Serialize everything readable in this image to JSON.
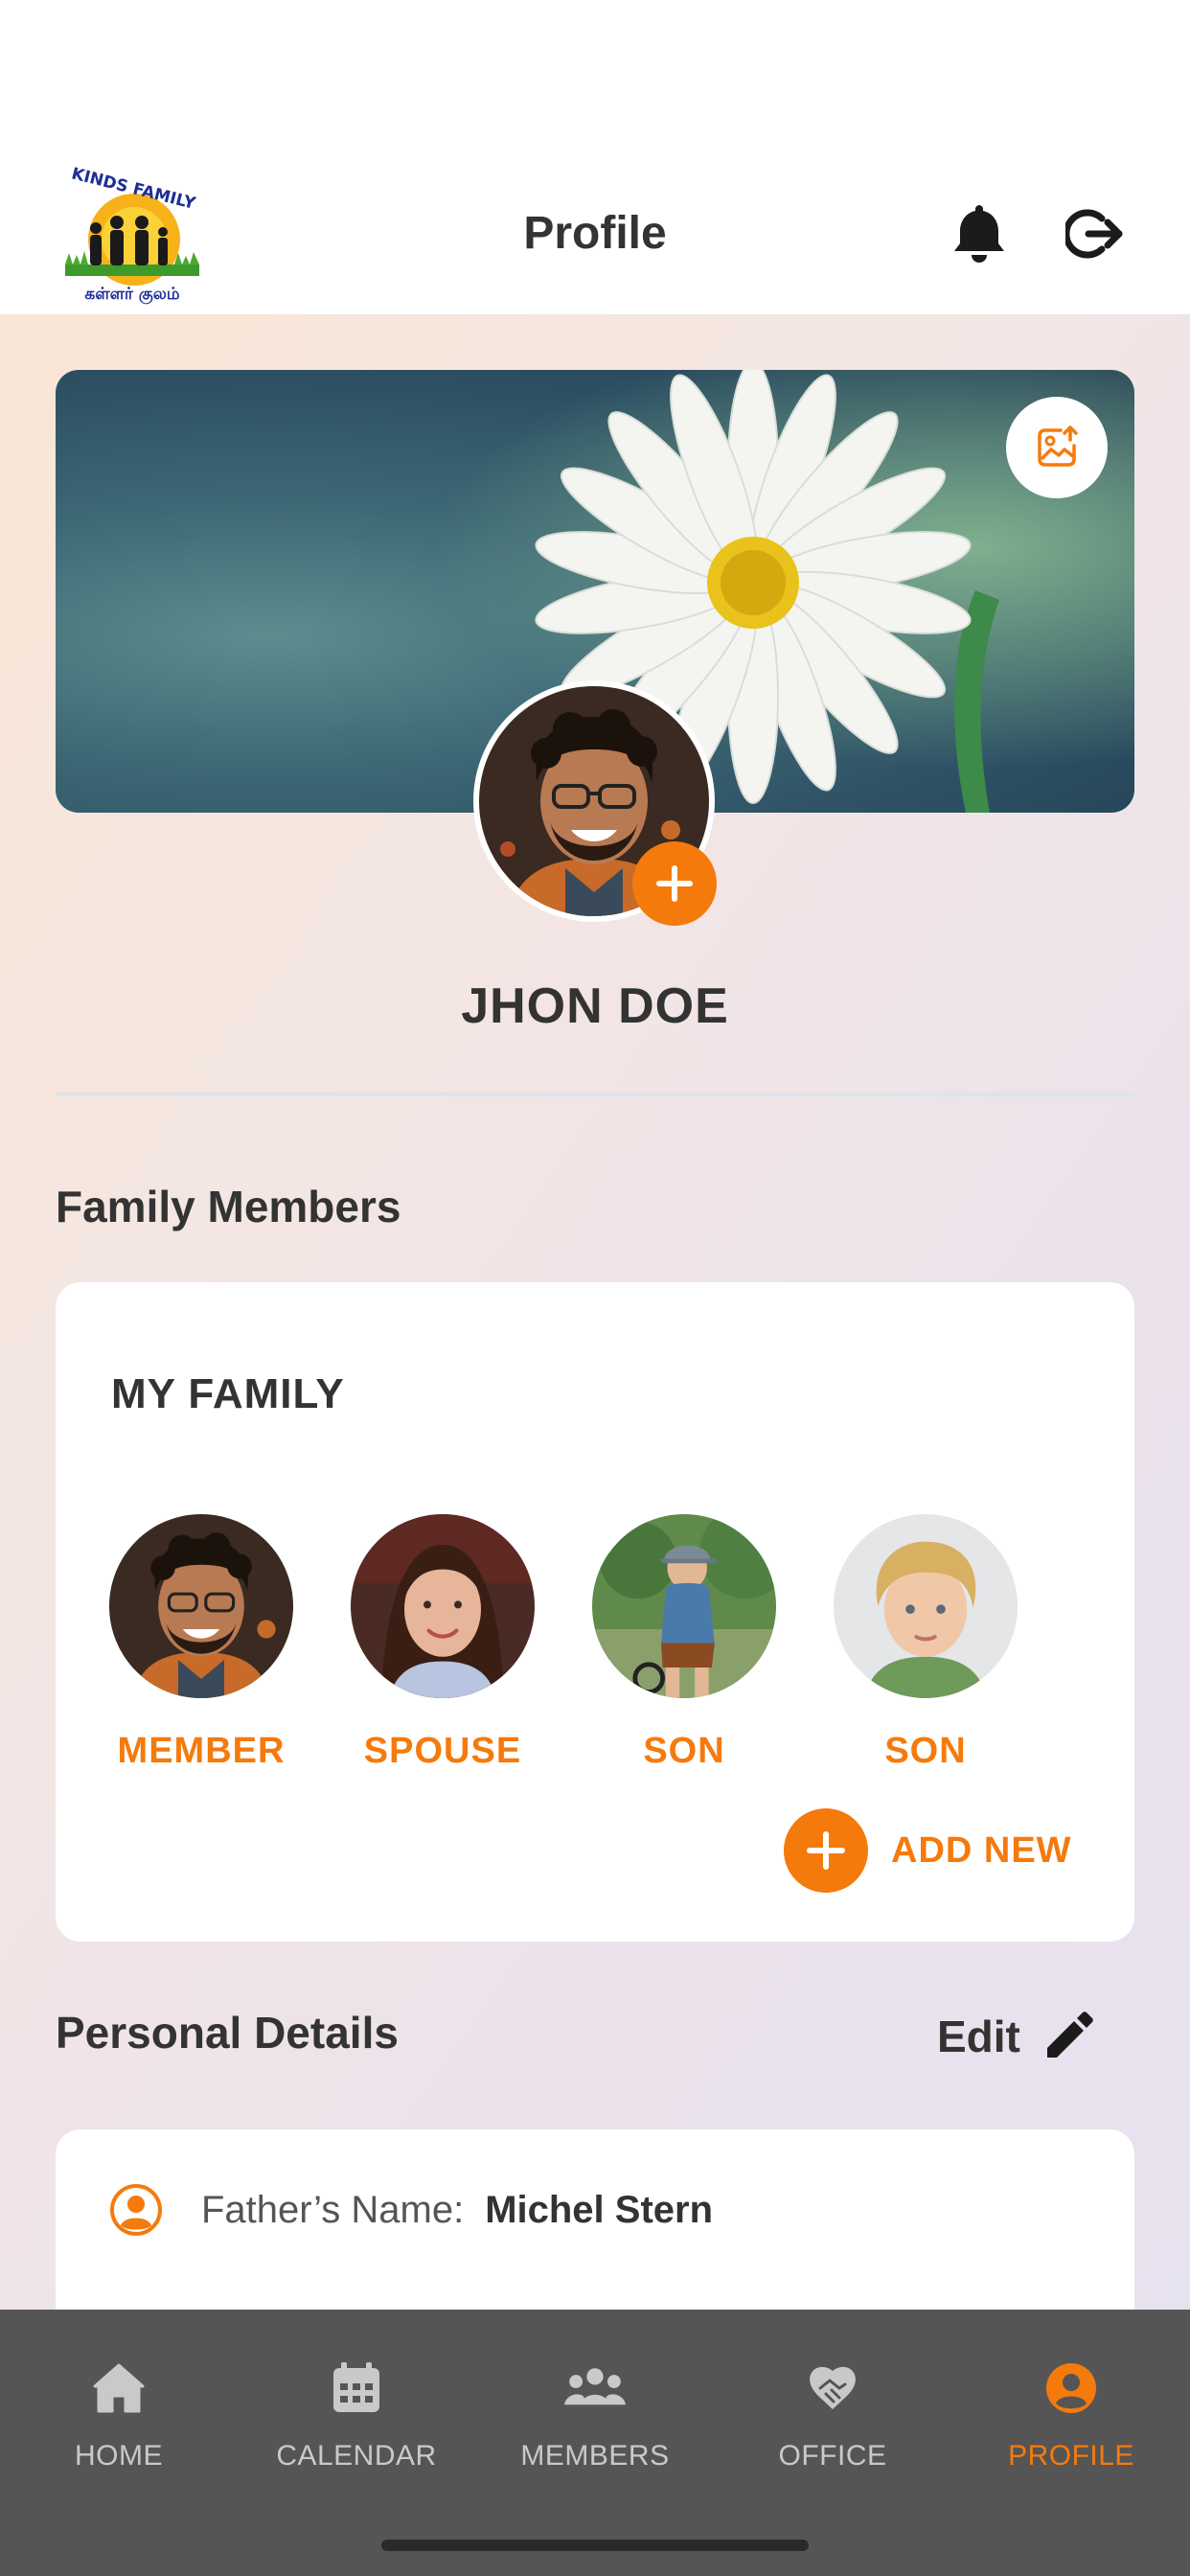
{
  "header": {
    "title": "Profile",
    "logo": {
      "top_text": "KINDS FAMILY",
      "bottom_text": "கள்ளர் குலம்"
    }
  },
  "profile": {
    "name": "JHON DOE"
  },
  "family_section": {
    "title": "Family Members",
    "card_title": "MY FAMILY",
    "members": [
      {
        "label": "MEMBER"
      },
      {
        "label": "SPOUSE"
      },
      {
        "label": "SON"
      },
      {
        "label": "SON"
      }
    ],
    "add_new_label": "ADD NEW"
  },
  "personal_details": {
    "title": "Personal Details",
    "edit_label": "Edit",
    "rows": [
      {
        "key": "Father’s Name:",
        "value": "Michel Stern"
      }
    ]
  },
  "bottom_nav": {
    "items": [
      {
        "label": "HOME",
        "icon": "home-icon"
      },
      {
        "label": "CALENDAR",
        "icon": "calendar-icon"
      },
      {
        "label": "MEMBERS",
        "icon": "members-icon"
      },
      {
        "label": "OFFICE",
        "icon": "office-icon"
      },
      {
        "label": "PROFILE",
        "icon": "profile-icon"
      }
    ],
    "active": "PROFILE"
  },
  "colors": {
    "accent": "#f57a0c",
    "text_dark": "#333333",
    "nav_bg": "#555555",
    "nav_inactive": "#c9c9c9"
  }
}
